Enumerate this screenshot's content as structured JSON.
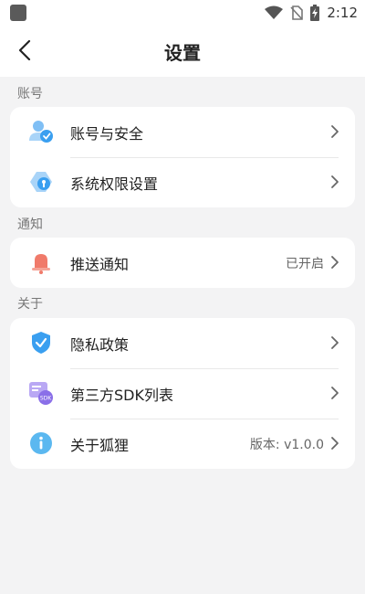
{
  "status_bar": {
    "time": "2:12"
  },
  "header": {
    "title": "设置"
  },
  "sections": [
    {
      "label": "账号",
      "items": [
        {
          "label": "账号与安全",
          "icon": "account-security-icon"
        },
        {
          "label": "系统权限设置",
          "icon": "system-permission-icon"
        }
      ]
    },
    {
      "label": "通知",
      "items": [
        {
          "label": "推送通知",
          "value": "已开启",
          "icon": "bell-icon"
        }
      ]
    },
    {
      "label": "关于",
      "items": [
        {
          "label": "隐私政策",
          "icon": "shield-icon"
        },
        {
          "label": "第三方SDK列表",
          "icon": "sdk-icon"
        },
        {
          "label": "关于狐狸",
          "value": "版本: v1.0.0",
          "icon": "info-icon"
        }
      ]
    }
  ],
  "colors": {
    "accent_blue": "#3a9ff0",
    "bell_red": "#f07a6a",
    "sdk_purple": "#8a6fe8"
  }
}
